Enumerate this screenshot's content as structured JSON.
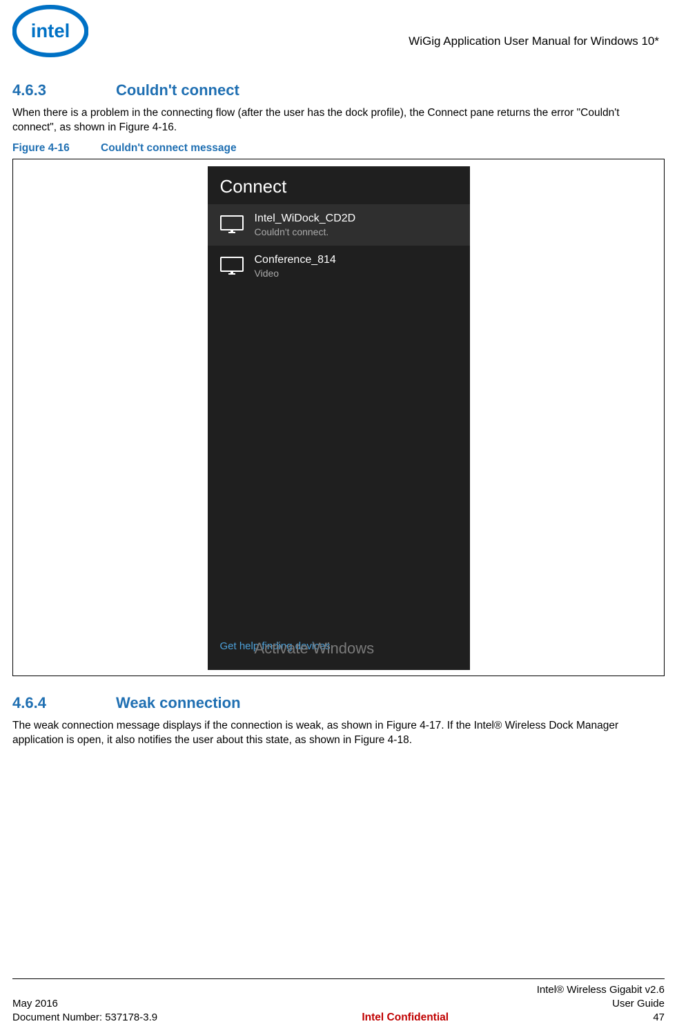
{
  "header": {
    "doc_title": "WiGig Application User Manual for Windows 10*"
  },
  "section1": {
    "number": "4.6.3",
    "title": "Couldn't connect",
    "body": "When there is a problem in the connecting flow (after the user has the dock profile), the Connect pane returns the error \"Couldn't connect\", as shown in Figure 4-16."
  },
  "figure1": {
    "number": "Figure 4-16",
    "caption": "Couldn't connect message",
    "pane": {
      "title": "Connect",
      "devices": [
        {
          "name": "Intel_WiDock_CD2D",
          "status": "Couldn't connect."
        },
        {
          "name": "Conference_814",
          "status": "Video"
        }
      ],
      "help_link": "Get help finding devices",
      "watermark": "Activate Windows"
    }
  },
  "section2": {
    "number": "4.6.4",
    "title": "Weak connection",
    "body": "The weak connection message displays if the connection is weak, as shown in Figure 4-17. If the Intel® Wireless Dock Manager application is open, it also notifies the user about this state, as shown in Figure 4-18."
  },
  "footer": {
    "left_line1": "May 2016",
    "left_line2": "Document Number: 537178-3.9",
    "center": "Intel Confidential",
    "right_line1": "Intel® Wireless Gigabit v2.6",
    "right_line2": "User Guide",
    "right_line3": "47"
  }
}
